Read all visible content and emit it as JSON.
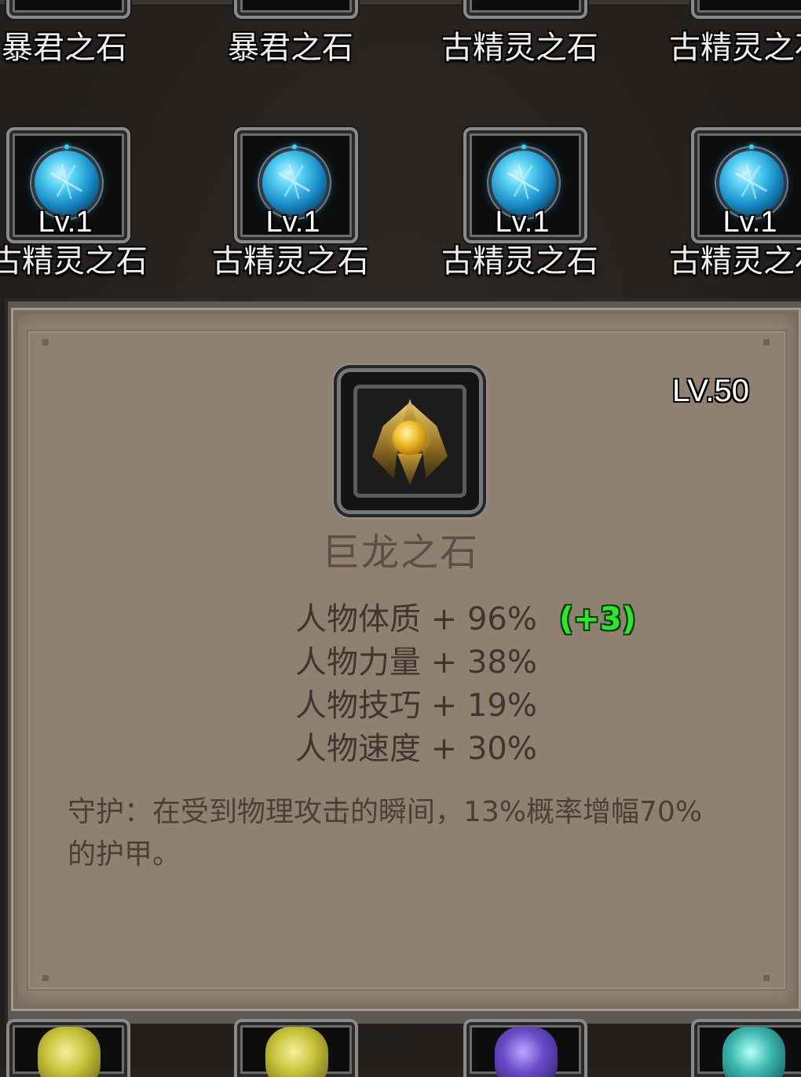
{
  "top_row": [
    {
      "name": "暴君之石"
    },
    {
      "name": "暴君之石"
    },
    {
      "name": "古精灵之石"
    },
    {
      "name": "古精灵之石"
    }
  ],
  "mid_row": [
    {
      "level": "Lv.1",
      "name": "古精灵之石"
    },
    {
      "level": "Lv.1",
      "name": "古精灵之石"
    },
    {
      "level": "Lv.1",
      "name": "古精灵之石"
    },
    {
      "level": "Lv.1",
      "name": "古精灵之石"
    }
  ],
  "detail": {
    "level": "LV.50",
    "name": "巨龙之石",
    "icon": "dragon-stone-icon",
    "stats": [
      "人物体质 + 96%",
      "人物力量 + 38%",
      "人物技巧 + 19%",
      "人物速度 + 30%"
    ],
    "bonus": "(+3)",
    "effect": "守护：在受到物理攻击的瞬间，13%概率增幅70%的护甲。"
  },
  "bottom_row": [
    {
      "icon": "yellow-gem-icon",
      "color": "#c9c43a"
    },
    {
      "icon": "yellow-gem-icon",
      "color": "#c9c43a"
    },
    {
      "icon": "purple-gem-icon",
      "color": "#6a4cc8"
    },
    {
      "icon": "teal-gem-icon",
      "color": "#3ab8b0"
    }
  ],
  "colors": {
    "panel": "#8f8070",
    "bonus_green": "#2ee62e",
    "orb_blue": "#1a8fc9"
  }
}
